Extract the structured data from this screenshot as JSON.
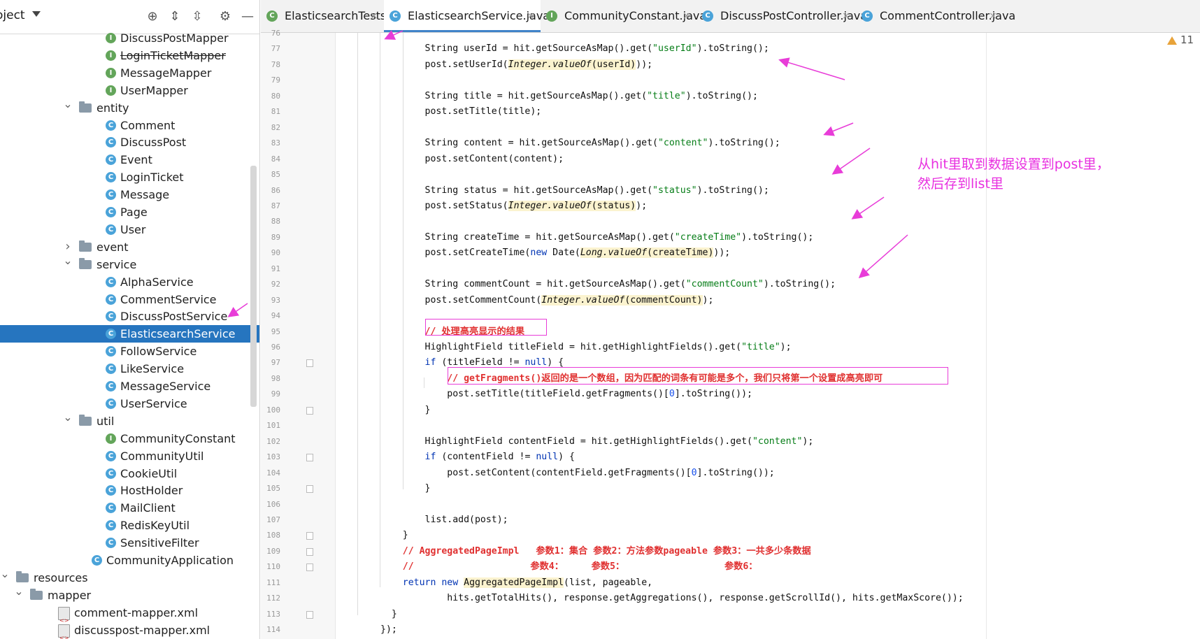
{
  "project_panel": {
    "title": "oject",
    "tree": [
      {
        "label": "DiscussPostMapper",
        "icon": "I",
        "indent": 150,
        "strike": false
      },
      {
        "label": "LoginTicketMapper",
        "icon": "I",
        "indent": 150,
        "strike": true
      },
      {
        "label": "MessageMapper",
        "icon": "I",
        "indent": 150,
        "strike": false
      },
      {
        "label": "UserMapper",
        "icon": "I",
        "indent": 150,
        "strike": false
      },
      {
        "label": "entity",
        "icon": "folder",
        "indent": 130,
        "arrow": "down"
      },
      {
        "label": "Comment",
        "icon": "C",
        "indent": 150
      },
      {
        "label": "DiscussPost",
        "icon": "C",
        "indent": 150
      },
      {
        "label": "Event",
        "icon": "C",
        "indent": 150
      },
      {
        "label": "LoginTicket",
        "icon": "C",
        "indent": 150
      },
      {
        "label": "Message",
        "icon": "C",
        "indent": 150
      },
      {
        "label": "Page",
        "icon": "C",
        "indent": 150
      },
      {
        "label": "User",
        "icon": "C",
        "indent": 150
      },
      {
        "label": "event",
        "icon": "folder",
        "indent": 130,
        "arrow": "right"
      },
      {
        "label": "service",
        "icon": "folder",
        "indent": 130,
        "arrow": "down"
      },
      {
        "label": "AlphaService",
        "icon": "C",
        "indent": 150
      },
      {
        "label": "CommentService",
        "icon": "C",
        "indent": 150
      },
      {
        "label": "DiscussPostService",
        "icon": "C",
        "indent": 150
      },
      {
        "label": "ElasticsearchService",
        "icon": "C",
        "indent": 150,
        "selected": true
      },
      {
        "label": "FollowService",
        "icon": "C",
        "indent": 150
      },
      {
        "label": "LikeService",
        "icon": "C",
        "indent": 150
      },
      {
        "label": "MessageService",
        "icon": "C",
        "indent": 150
      },
      {
        "label": "UserService",
        "icon": "C",
        "indent": 150
      },
      {
        "label": "util",
        "icon": "folder",
        "indent": 130,
        "arrow": "down"
      },
      {
        "label": "CommunityConstant",
        "icon": "I",
        "indent": 150
      },
      {
        "label": "CommunityUtil",
        "icon": "C",
        "indent": 150
      },
      {
        "label": "CookieUtil",
        "icon": "C",
        "indent": 150
      },
      {
        "label": "HostHolder",
        "icon": "C",
        "indent": 150
      },
      {
        "label": "MailClient",
        "icon": "C",
        "indent": 150
      },
      {
        "label": "RedisKeyUtil",
        "icon": "C",
        "indent": 150
      },
      {
        "label": "SensitiveFilter",
        "icon": "C",
        "indent": 150
      },
      {
        "label": "CommunityApplication",
        "icon": "C",
        "indent": 130
      },
      {
        "label": "resources",
        "icon": "folder",
        "indent": 40,
        "arrow": "down"
      },
      {
        "label": "mapper",
        "icon": "folder",
        "indent": 60,
        "arrow": "down"
      },
      {
        "label": "comment-mapper.xml",
        "icon": "xml",
        "indent": 85
      },
      {
        "label": "discusspost-mapper.xml",
        "icon": "xml",
        "indent": 85
      }
    ]
  },
  "tabs": [
    {
      "label": "ElasticsearchTests.java",
      "icon": "C",
      "color": "#63a55a",
      "active": false
    },
    {
      "label": "ElasticsearchService.java",
      "icon": "C",
      "color": "#4aa3d9",
      "active": true
    },
    {
      "label": "CommunityConstant.java",
      "icon": "I",
      "color": "#63a55a",
      "active": false
    },
    {
      "label": "DiscussPostController.java",
      "icon": "C",
      "color": "#4aa3d9",
      "active": false
    },
    {
      "label": "CommentController.java",
      "icon": "C",
      "color": "#4aa3d9",
      "active": false
    }
  ],
  "warnings": "11",
  "annotation": [
    "从hit里取到数据设置到post里，",
    "然后存到list里"
  ],
  "line_numbers": [
    "76",
    "77",
    "78",
    "79",
    "80",
    "81",
    "82",
    "83",
    "84",
    "85",
    "86",
    "87",
    "88",
    "89",
    "90",
    "91",
    "92",
    "93",
    "94",
    "95",
    "96",
    "97",
    "98",
    "99",
    "100",
    "101",
    "102",
    "103",
    "104",
    "105",
    "106",
    "107",
    "108",
    "109",
    "110",
    "111",
    "112",
    "113",
    "114"
  ],
  "code": [
    [],
    [
      [
        "",
        "        String userId = hit.getSourceAsMap().get("
      ],
      [
        "str",
        "\"userId\""
      ],
      [
        "",
        ").toString();"
      ]
    ],
    [
      [
        "",
        "        post.setUserId("
      ],
      [
        "hl it",
        "Integer.valueOf"
      ],
      [
        "hl",
        "(userId)"
      ],
      [
        "",
        "));"
      ]
    ],
    [],
    [
      [
        "",
        "        String title = hit.getSourceAsMap().get("
      ],
      [
        "str",
        "\"title\""
      ],
      [
        "",
        ").toString();"
      ]
    ],
    [
      [
        "",
        "        post.setTitle(title);"
      ]
    ],
    [],
    [
      [
        "",
        "        String content = hit.getSourceAsMap().get("
      ],
      [
        "str",
        "\"content\""
      ],
      [
        "",
        ").toString();"
      ]
    ],
    [
      [
        "",
        "        post.setContent(content);"
      ]
    ],
    [],
    [
      [
        "",
        "        String status = hit.getSourceAsMap().get("
      ],
      [
        "str",
        "\"status\""
      ],
      [
        "",
        ").toString();"
      ]
    ],
    [
      [
        "",
        "        post.setStatus("
      ],
      [
        "hl it",
        "Integer.valueOf"
      ],
      [
        "hl",
        "(status)"
      ],
      [
        "",
        ");"
      ]
    ],
    [],
    [
      [
        "",
        "        String createTime = hit.getSourceAsMap().get("
      ],
      [
        "str",
        "\"createTime\""
      ],
      [
        "",
        ").toString();"
      ]
    ],
    [
      [
        "",
        "        post.setCreateTime("
      ],
      [
        "kw",
        "new"
      ],
      [
        "",
        " Date("
      ],
      [
        "hl it",
        "Long.valueOf"
      ],
      [
        "hl",
        "(createTime)"
      ],
      [
        "",
        "));"
      ]
    ],
    [],
    [
      [
        "",
        "        String commentCount = hit.getSourceAsMap().get("
      ],
      [
        "str",
        "\"commentCount\""
      ],
      [
        "",
        ").toString();"
      ]
    ],
    [
      [
        "",
        "        post.setCommentCount("
      ],
      [
        "hl it",
        "Integer.valueOf"
      ],
      [
        "hl",
        "(commentCount)"
      ],
      [
        "",
        ");"
      ]
    ],
    [],
    [
      [
        "",
        "        "
      ],
      [
        "cm",
        "// 处理高亮显示的结果"
      ]
    ],
    [
      [
        "",
        "        HighlightField titleField = hit.getHighlightFields().get("
      ],
      [
        "str",
        "\"title\""
      ],
      [
        "",
        ");"
      ]
    ],
    [
      [
        "",
        "        "
      ],
      [
        "kw",
        "if"
      ],
      [
        "",
        " (titleField != "
      ],
      [
        "kw",
        "null"
      ],
      [
        "",
        ") {"
      ]
    ],
    [
      [
        "",
        "            "
      ],
      [
        "cm",
        "// getFragments()返回的是一个数组，因为匹配的词条有可能是多个，我们只将第一个设置成高亮即可"
      ]
    ],
    [
      [
        "",
        "            post.setTitle(titleField.getFragments()["
      ],
      [
        "num",
        "0"
      ],
      [
        "",
        "].toString());"
      ]
    ],
    [
      [
        "",
        "        }"
      ]
    ],
    [],
    [
      [
        "",
        "        HighlightField contentField = hit.getHighlightFields().get("
      ],
      [
        "str",
        "\"content\""
      ],
      [
        "",
        ");"
      ]
    ],
    [
      [
        "",
        "        "
      ],
      [
        "kw",
        "if"
      ],
      [
        "",
        " (contentField != "
      ],
      [
        "kw",
        "null"
      ],
      [
        "",
        ") {"
      ]
    ],
    [
      [
        "",
        "            post.setContent(contentField.getFragments()["
      ],
      [
        "num",
        "0"
      ],
      [
        "",
        "].toString());"
      ]
    ],
    [
      [
        "",
        "        }"
      ]
    ],
    [],
    [
      [
        "",
        "        list.add(post);"
      ]
    ],
    [
      [
        "",
        "    }"
      ]
    ],
    [
      [
        "",
        "    "
      ],
      [
        "cm",
        "// AggregatedPageImpl   参数1：集合 参数2：方法参数pageable 参数3：一共多少条数据"
      ]
    ],
    [
      [
        "",
        "    "
      ],
      [
        "cm",
        "//                     参数4：     参数5：                  参数6："
      ]
    ],
    [
      [
        "",
        "    "
      ],
      [
        "kw",
        "return new"
      ],
      [
        "",
        " "
      ],
      [
        "hl",
        "AggregatedPageImpl"
      ],
      [
        "",
        "(list, pageable,"
      ]
    ],
    [
      [
        "",
        "            hits.getTotalHits(), response.getAggregations(), response.getScrollId(), hits.getMaxScore());"
      ]
    ],
    [
      [
        "",
        "  }"
      ]
    ],
    [
      [
        "",
        "});"
      ]
    ]
  ]
}
